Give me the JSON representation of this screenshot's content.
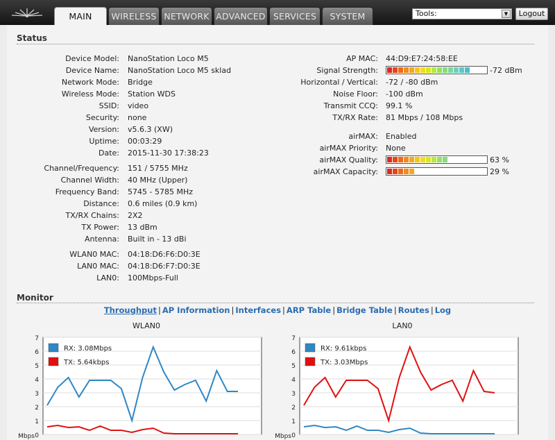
{
  "nav": {
    "tabs": [
      {
        "label": "MAIN",
        "active": true
      },
      {
        "label": "WIRELESS"
      },
      {
        "label": "NETWORK"
      },
      {
        "label": "ADVANCED"
      },
      {
        "label": "SERVICES"
      },
      {
        "label": "SYSTEM"
      }
    ],
    "tools_label": "Tools:",
    "logout_label": "Logout"
  },
  "status": {
    "title": "Status",
    "left": [
      {
        "label": "Device Model:",
        "value": "NanoStation Loco M5"
      },
      {
        "label": "Device Name:",
        "value": "NanoStation Loco M5 sklad"
      },
      {
        "label": "Network Mode:",
        "value": "Bridge"
      },
      {
        "label": "Wireless Mode:",
        "value": "Station WDS"
      },
      {
        "label": "SSID:",
        "value": "video"
      },
      {
        "label": "Security:",
        "value": "none"
      },
      {
        "label": "Version:",
        "value": "v5.6.3 (XW)"
      },
      {
        "label": "Uptime:",
        "value": "00:03:29"
      },
      {
        "label": "Date:",
        "value": "2015-11-30 17:38:23"
      },
      {
        "label": "Channel/Frequency:",
        "value": "151 / 5755 MHz"
      },
      {
        "label": "Channel Width:",
        "value": "40 MHz (Upper)"
      },
      {
        "label": "Frequency Band:",
        "value": "5745 - 5785 MHz"
      },
      {
        "label": "Distance:",
        "value": "0.6 miles (0.9 km)"
      },
      {
        "label": "TX/RX Chains:",
        "value": "2X2"
      },
      {
        "label": "TX Power:",
        "value": "13 dBm"
      },
      {
        "label": "Antenna:",
        "value": "Built in - 13 dBi"
      },
      {
        "label": "WLAN0 MAC:",
        "value": "04:18:D6:F6:D0:3E"
      },
      {
        "label": "LAN0 MAC:",
        "value": "04:18:D6:F7:D0:3E"
      },
      {
        "label": "LAN0:",
        "value": "100Mbps-Full"
      }
    ],
    "right": [
      {
        "label": "AP MAC:",
        "value": "44:D9:E7:24:58:EE"
      },
      {
        "label": "Signal Strength:",
        "value": "-72 dBm"
      },
      {
        "label": "Horizontal / Vertical:",
        "value": "-72 / -80 dBm"
      },
      {
        "label": "Noise Floor:",
        "value": "-100 dBm"
      },
      {
        "label": "Transmit CCQ:",
        "value": "99.1 %"
      },
      {
        "label": "TX/RX Rate:",
        "value": "81 Mbps / 108 Mbps"
      },
      {
        "label": "airMAX:",
        "value": "Enabled"
      },
      {
        "label": "airMAX Priority:",
        "value": "None"
      },
      {
        "label": "airMAX Quality:",
        "value": "63 %"
      },
      {
        "label": "airMAX Capacity:",
        "value": "29 %"
      }
    ],
    "signal_level": 0.83,
    "quality_level": 0.63,
    "capacity_level": 0.29
  },
  "monitor": {
    "title": "Monitor",
    "links": [
      "Throughput",
      "AP Information",
      "Interfaces",
      "ARP Table",
      "Bridge Table",
      "Routes",
      "Log"
    ],
    "active_link": "Throughput",
    "colors": {
      "rx": "#2f87c4",
      "tx": "#e01010"
    }
  },
  "chart_data": [
    {
      "type": "line",
      "title": "WLAN0",
      "ylabel": "Mbps",
      "ylim": [
        0,
        7
      ],
      "yticks": [
        "0",
        "1",
        "2",
        "3",
        "4",
        "5",
        "6",
        "7"
      ],
      "series": [
        {
          "name": "RX: 3.08Mbps",
          "values": [
            2.1,
            3.4,
            4.1,
            2.7,
            3.9,
            3.9,
            3.9,
            3.3,
            1.0,
            4.1,
            6.3,
            4.5,
            3.2,
            3.6,
            3.9,
            2.4,
            4.6,
            3.1,
            3.1
          ]
        },
        {
          "name": "TX: 5.64kbps",
          "values": [
            0.55,
            0.65,
            0.5,
            0.55,
            0.3,
            0.6,
            0.3,
            0.3,
            0.15,
            0.35,
            0.45,
            0.1,
            0.05,
            0.05,
            0.05,
            0.05,
            0.05,
            0.05,
            0.05
          ]
        }
      ]
    },
    {
      "type": "line",
      "title": "LAN0",
      "ylabel": "Mbps",
      "ylim": [
        0,
        7
      ],
      "yticks": [
        "0",
        "1",
        "2",
        "3",
        "4",
        "5",
        "6",
        "7"
      ],
      "series": [
        {
          "name": "RX: 9.61kbps",
          "values": [
            0.55,
            0.65,
            0.5,
            0.55,
            0.3,
            0.6,
            0.3,
            0.3,
            0.15,
            0.35,
            0.45,
            0.1,
            0.05,
            0.05,
            0.05,
            0.05,
            0.05,
            0.05,
            0.05
          ]
        },
        {
          "name": "TX: 3.03Mbps",
          "values": [
            2.1,
            3.4,
            4.1,
            2.7,
            3.9,
            3.9,
            3.9,
            3.3,
            1.0,
            4.1,
            6.3,
            4.5,
            3.2,
            3.6,
            3.9,
            2.4,
            4.6,
            3.1,
            3.0
          ]
        }
      ]
    }
  ]
}
